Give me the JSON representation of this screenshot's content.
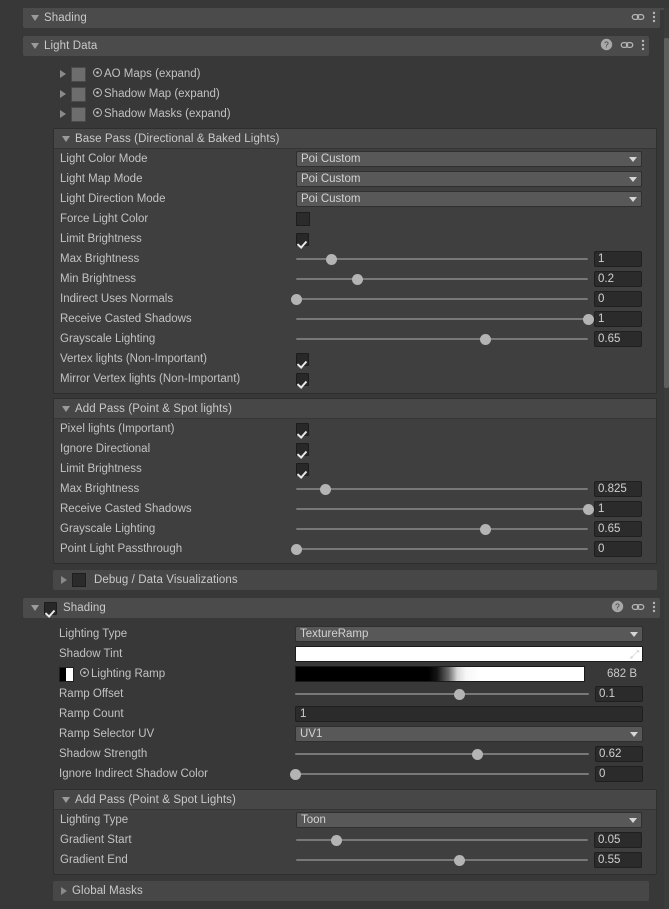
{
  "colors": {
    "window_bg": "#383838",
    "header_bg": "#4b4b4b",
    "panel_bg": "#3f3f3f",
    "field_bg": "#2b2b2b",
    "dropdown_bg": "#585858",
    "text": "#c2c2c2",
    "knob": "#b4b4b4",
    "shadow_tint_swatch": "#ffffff",
    "force_light_color_swatch": "#2b2b2b"
  },
  "shading_root": {
    "label": "Shading",
    "expanded": true,
    "icons": [
      "link-icon",
      "kebab-menu-icon"
    ]
  },
  "light_data": {
    "label": "Light Data",
    "expanded": true,
    "icons": [
      "help-icon",
      "link-icon",
      "kebab-menu-icon"
    ],
    "texture_rows": [
      {
        "label": "AO Maps (expand)",
        "expanded": false
      },
      {
        "label": "Shadow Map (expand)",
        "expanded": false
      },
      {
        "label": "Shadow Masks (expand)",
        "expanded": false
      }
    ],
    "base_pass": {
      "label": "Base Pass (Directional & Baked Lights)",
      "expanded": true,
      "rows": [
        {
          "type": "dropdown",
          "label": "Light Color Mode",
          "value": "Poi Custom"
        },
        {
          "type": "dropdown",
          "label": "Light Map Mode",
          "value": "Poi Custom"
        },
        {
          "type": "dropdown",
          "label": "Light Direction Mode",
          "value": "Poi Custom"
        },
        {
          "type": "color",
          "label": "Force Light Color",
          "value": "#2b2b2b"
        },
        {
          "type": "checkbox",
          "label": "Limit Brightness",
          "value": true
        },
        {
          "type": "slider",
          "label": "Max Brightness",
          "value": "1",
          "fill": 12
        },
        {
          "type": "slider",
          "label": "Min Brightness",
          "value": "0.2",
          "fill": 21
        },
        {
          "type": "slider",
          "label": "Indirect Uses Normals",
          "value": "0",
          "fill": 0
        },
        {
          "type": "slider",
          "label": "Receive Casted Shadows",
          "value": "1",
          "fill": 100
        },
        {
          "type": "slider",
          "label": "Grayscale Lighting",
          "value": "0.65",
          "fill": 65
        },
        {
          "type": "checkbox",
          "label": "Vertex lights (Non-Important)",
          "value": true
        },
        {
          "type": "checkbox",
          "label": "Mirror Vertex lights (Non-Important)",
          "value": true
        }
      ]
    },
    "add_pass": {
      "label": "Add Pass (Point & Spot lights)",
      "expanded": true,
      "rows": [
        {
          "type": "checkbox",
          "label": "Pixel lights (Important)",
          "value": true
        },
        {
          "type": "checkbox",
          "label": "Ignore Directional",
          "value": true
        },
        {
          "type": "checkbox",
          "label": "Limit Brightness",
          "value": true
        },
        {
          "type": "slider",
          "label": "Max Brightness",
          "value": "0.825",
          "fill": 10
        },
        {
          "type": "slider",
          "label": "Receive Casted Shadows",
          "value": "1",
          "fill": 100
        },
        {
          "type": "slider",
          "label": "Grayscale Lighting",
          "value": "0.65",
          "fill": 65
        },
        {
          "type": "slider",
          "label": "Point Light Passthrough",
          "value": "0",
          "fill": 0
        }
      ]
    },
    "debug_row": {
      "label": "Debug / Data Visualizations",
      "expanded": false
    }
  },
  "shading_section": {
    "label": "Shading",
    "expanded": true,
    "enabled": true,
    "icons": [
      "help-icon",
      "link-icon",
      "kebab-menu-icon"
    ],
    "rows": [
      {
        "type": "dropdown",
        "label": "Lighting Type",
        "value": "TextureRamp"
      },
      {
        "type": "colorfield",
        "label": "Shadow Tint",
        "value": "#ffffff",
        "icon": "eyedropper-icon"
      },
      {
        "type": "ramp",
        "label": "Lighting Ramp",
        "size": "682 B"
      },
      {
        "type": "slider",
        "label": "Ramp Offset",
        "value": "0.1",
        "fill": 56
      },
      {
        "type": "text",
        "label": "Ramp Count",
        "value": "1"
      },
      {
        "type": "dropdown",
        "label": "Ramp Selector UV",
        "value": "UV1"
      },
      {
        "type": "slider",
        "label": "Shadow Strength",
        "value": "0.62",
        "fill": 62
      },
      {
        "type": "slider",
        "label": "Ignore Indirect Shadow Color",
        "value": "0",
        "fill": 0
      }
    ],
    "add_pass": {
      "label": "Add Pass (Point & Spot Lights)",
      "expanded": true,
      "rows": [
        {
          "type": "dropdown",
          "label": "Lighting Type",
          "value": "Toon"
        },
        {
          "type": "slider",
          "label": "Gradient Start",
          "value": "0.05",
          "fill": 14
        },
        {
          "type": "slider",
          "label": "Gradient End",
          "value": "0.55",
          "fill": 56
        }
      ]
    },
    "global_masks": {
      "label": "Global Masks",
      "expanded": false
    }
  }
}
